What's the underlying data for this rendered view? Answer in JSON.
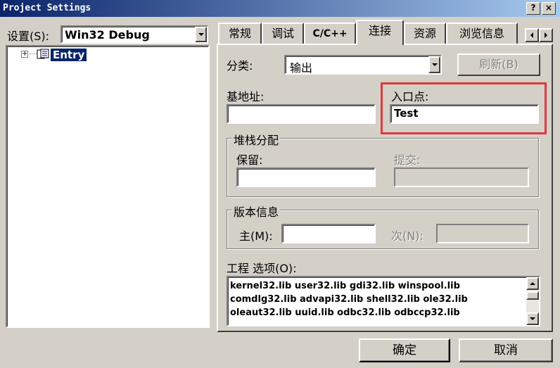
{
  "window": {
    "title": "Project Settings",
    "help_btn": "?",
    "close_btn": "×"
  },
  "left": {
    "settings_label": "设置(S):",
    "config_value": "Win32 Debug",
    "tree": {
      "expander": "⊞",
      "project_name": "Entry"
    }
  },
  "tabs": [
    {
      "label": "常规"
    },
    {
      "label": "调试"
    },
    {
      "label": "C/C++"
    },
    {
      "label": "连接",
      "active": true
    },
    {
      "label": "资源"
    },
    {
      "label": "浏览信息"
    }
  ],
  "category": {
    "label": "分类:",
    "value": "输出",
    "reset_button": "刷新(B)"
  },
  "base_address": {
    "label": "基地址:",
    "value": ""
  },
  "entry_point": {
    "label": "入口点:",
    "value": "Test"
  },
  "stack": {
    "group_label": "堆栈分配",
    "reserve_label": "保留:",
    "reserve_value": "",
    "commit_label": "提交:",
    "commit_value": ""
  },
  "version": {
    "group_label": "版本信息",
    "major_label": "主(M):",
    "major_value": "",
    "minor_label": "次(N):",
    "minor_value": ""
  },
  "project_options": {
    "label": "工程 选项(O):",
    "lines": [
      "kernel32.lib user32.lib gdi32.lib winspool.lib",
      "comdlg32.lib advapi32.lib shell32.lib ole32.lib",
      "oleaut32.lib uuid.lib odbc32.lib odbccp32.lib"
    ]
  },
  "buttons": {
    "ok": "确定",
    "cancel": "取消"
  },
  "colors": {
    "highlight_box": "#e0393e",
    "title_bar": "#0a246a",
    "face": "#d4d0c8"
  }
}
